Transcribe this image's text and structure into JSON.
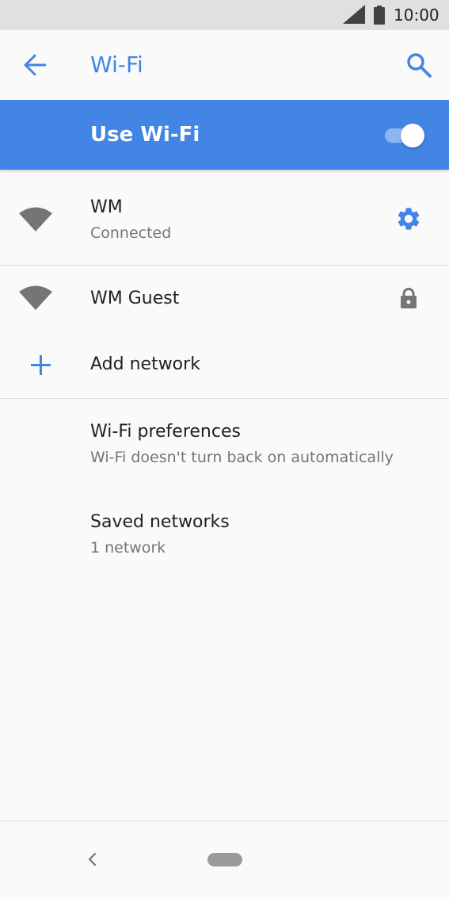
{
  "status_bar": {
    "time": "10:00",
    "icons": [
      "signal-icon",
      "battery-icon"
    ]
  },
  "app_bar": {
    "title": "Wi-Fi",
    "back_icon": "arrow-back-icon",
    "search_icon": "search-icon"
  },
  "master_switch": {
    "label": "Use Wi-Fi",
    "enabled": true
  },
  "networks": [
    {
      "name": "WM",
      "status": "Connected",
      "icon": "wifi-signal-icon",
      "action_icon": "gear-icon"
    },
    {
      "name": "WM Guest",
      "icon": "wifi-signal-icon",
      "action_icon": "lock-icon"
    }
  ],
  "add_network": {
    "label": "Add network",
    "icon": "plus-icon"
  },
  "preferences": {
    "title": "Wi-Fi preferences",
    "subtitle": "Wi-Fi doesn't turn back on automatically"
  },
  "saved_networks": {
    "title": "Saved networks",
    "subtitle": "1 network"
  },
  "nav_bar": {
    "icons": [
      "nav-back-icon",
      "home-pill-icon"
    ]
  },
  "colors": {
    "accent": "#4285e4",
    "status_bar_bg": "#e0e0e0",
    "background": "#fafafa",
    "icon_gray": "#757575"
  }
}
